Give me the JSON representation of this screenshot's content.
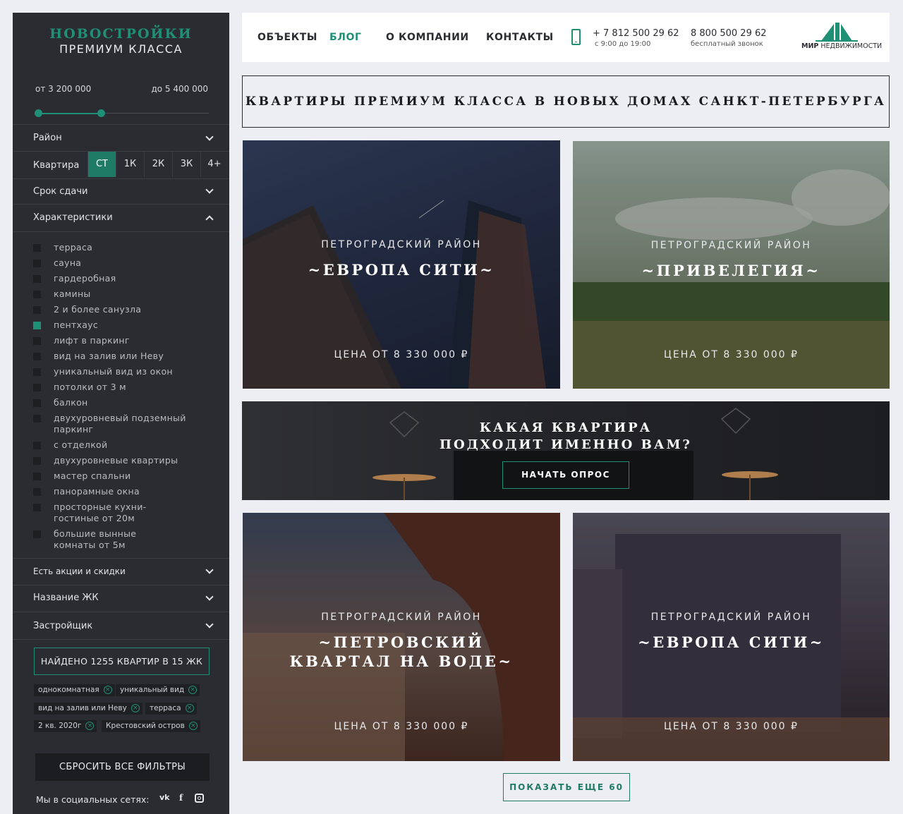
{
  "sidebar": {
    "brand_line1": "НОВОСТРОЙКИ",
    "brand_line2": "ПРЕМИУМ КЛАССА",
    "price_from": "от 3 200 000",
    "price_to": "до 5 400 000",
    "price_range_fraction": [
      0.0,
      0.37
    ],
    "district_label": "Район",
    "apartment_label": "Квартира",
    "apartment_options": [
      "СТ",
      "1К",
      "2К",
      "3К",
      "4+"
    ],
    "apartment_selected": "СТ",
    "deadline_label": "Срок сдачи",
    "features_label": "Характеристики",
    "features": [
      {
        "label": "терраса",
        "checked": false
      },
      {
        "label": "сауна",
        "checked": false
      },
      {
        "label": "гардеробная",
        "checked": false
      },
      {
        "label": "камины",
        "checked": false
      },
      {
        "label": "2 и более санузла",
        "checked": false
      },
      {
        "label": "пентхаус",
        "checked": true
      },
      {
        "label": "лифт в паркинг",
        "checked": false
      },
      {
        "label": "вид на залив или Неву",
        "checked": false
      },
      {
        "label": "уникальный вид из окон",
        "checked": false
      },
      {
        "label": "потолки от 3 м",
        "checked": false
      },
      {
        "label": "балкон",
        "checked": false
      },
      {
        "label": "двухуровневый подземный паркинг",
        "checked": false
      },
      {
        "label": "с отделкой",
        "checked": false
      },
      {
        "label": "двухуровневые квартиры",
        "checked": false
      },
      {
        "label": "мастер спальни",
        "checked": false
      },
      {
        "label": "панорамные окна",
        "checked": false
      },
      {
        "label": "просторные кухни-гостиные от 20м",
        "checked": false
      },
      {
        "label": "большие вынные комнаты от 5м",
        "checked": false
      }
    ],
    "promo_label": "Есть акции и скидки",
    "complex_label": "Название ЖК",
    "developer_label": "Застройщик",
    "found_text": "НАЙДЕНО 1255 КВАРТИР В 15 ЖК",
    "chips": [
      "однокомнатная",
      "уникальный вид",
      "вид на залив или Неву",
      "терраса",
      "2 кв. 2020г",
      "Крестовский остров"
    ],
    "reset_label": "СБРОСИТЬ ВСЕ ФИЛЬТРЫ",
    "social_label": "Мы в социальных сетях:",
    "social_icons": [
      "vk-icon",
      "facebook-icon",
      "instagram-icon"
    ]
  },
  "header": {
    "nav": [
      "ОБЪЕКТЫ",
      "БЛОГ",
      "О КОМПАНИИ",
      "КОНТАКТЫ"
    ],
    "nav_active": "БЛОГ",
    "phone1": "+ 7 812 500 29 62",
    "phone1_hours": "с 9:00 до 19:00",
    "phone2": "8 800 500 29 62",
    "phone2_note": "бесплатный звонок",
    "logo_bold": "МИР",
    "logo_rest": " НЕДВИЖИМОСТИ"
  },
  "headline": "КВАРТИРЫ ПРЕМИУМ КЛАССА В НОВЫХ ДОМАХ САНКТ-ПЕТЕРБУРГА",
  "cards": [
    {
      "district": "ПЕТРОГРАДСКИЙ РАЙОН",
      "name": "~ЕВРОПА СИТИ~",
      "price": "ЦЕНА ОТ 8 330 000 ₽"
    },
    {
      "district": "ПЕТРОГРАДСКИЙ РАЙОН",
      "name": "~ПРИВЕЛЕГИЯ~",
      "price": "ЦЕНА ОТ 8 330 000 ₽"
    },
    {
      "district": "ПЕТРОГРАДСКИЙ РАЙОН",
      "name": "~ПЕТРОВСКИЙ КВАРТАЛ НА ВОДЕ~",
      "price": "ЦЕНА ОТ 8 330 000 ₽"
    },
    {
      "district": "ПЕТРОГРАДСКИЙ РАЙОН",
      "name": "~ЕВРОПА СИТИ~",
      "price": "ЦЕНА ОТ 8 330 000 ₽"
    }
  ],
  "banner": {
    "question": "КАКАЯ КВАРТИРА ПОДХОДИТ ИМЕННО ВАМ?",
    "button": "НАЧАТЬ ОПРОС"
  },
  "show_more": "ПОКАЗАТЬ ЕЩЕ 60",
  "colors": {
    "accent": "#1f8f75",
    "sidebar_bg": "#2a2c31",
    "page_bg": "#eceef3"
  }
}
